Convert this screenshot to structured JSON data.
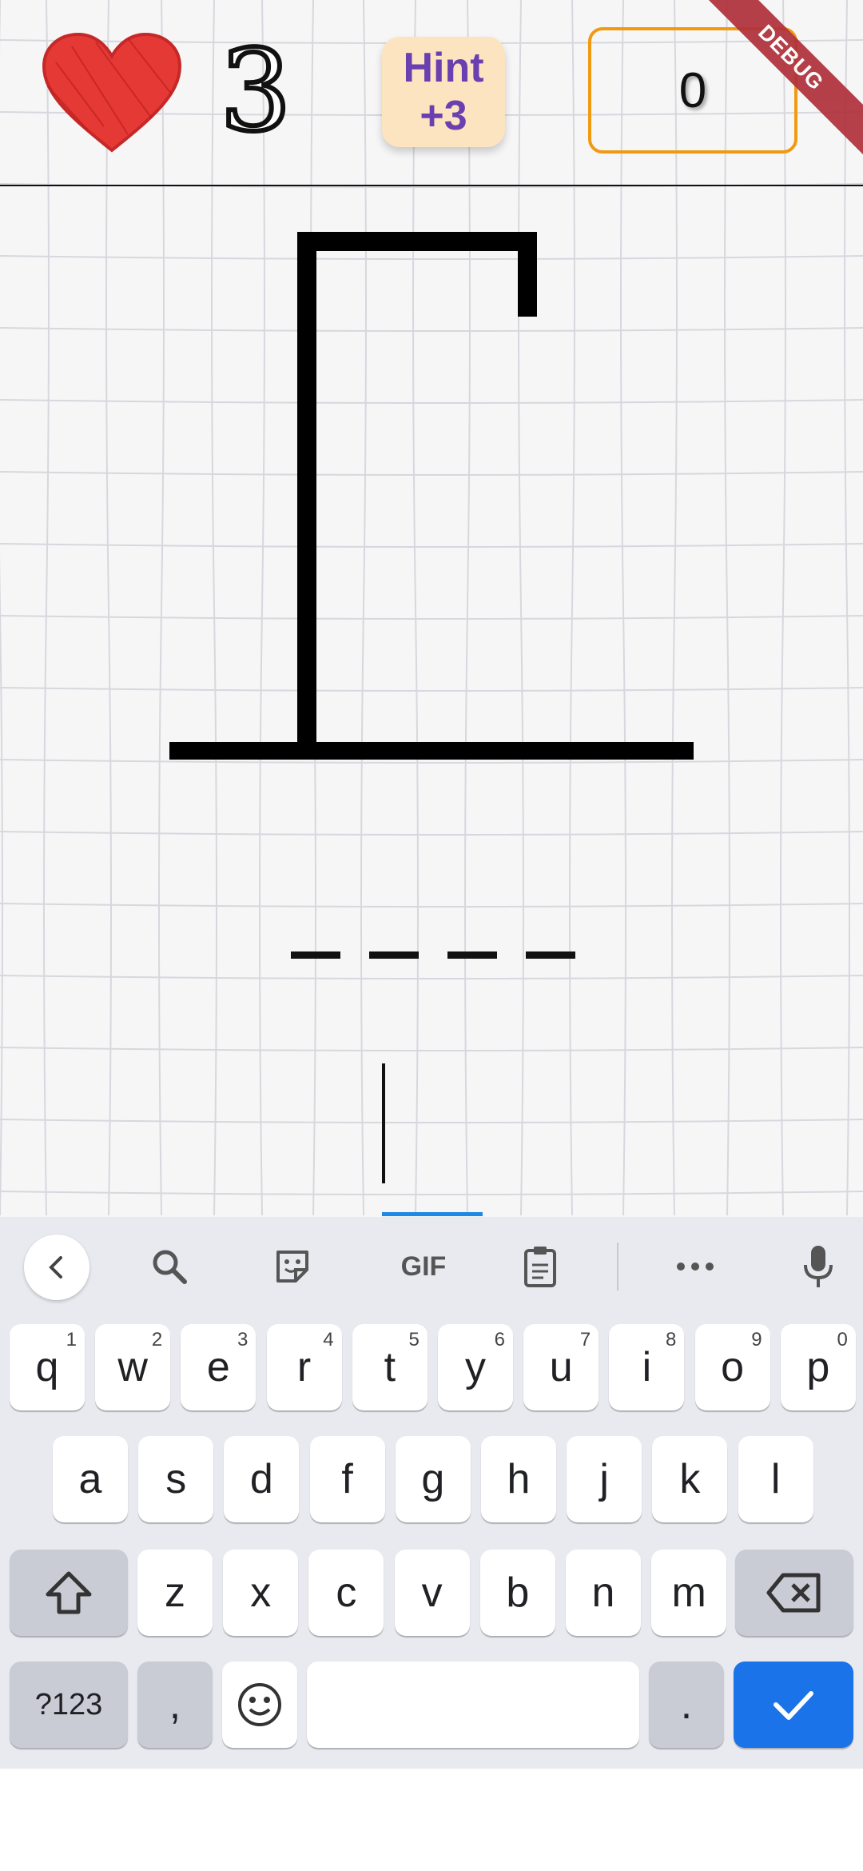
{
  "header": {
    "lives_count": "3",
    "hint_label": "Hint",
    "hint_value": "+3",
    "score": "0",
    "debug_banner": "DEBUG"
  },
  "colors": {
    "heart": "#e53935",
    "hint_bg": "#fde4c1",
    "hint_text": "#6a3fb0",
    "score_border": "#f09a12",
    "input_underline": "#1e88e5",
    "done_key": "#1a73e8"
  },
  "word": {
    "blank_count": 4
  },
  "guess_input": {
    "value": ""
  },
  "keyboard": {
    "toolbar": [
      "back-icon",
      "search-icon",
      "sticker-icon",
      "GIF",
      "clipboard-icon",
      "more-icon",
      "mic-icon"
    ],
    "row1": [
      {
        "key": "q",
        "hint": "1"
      },
      {
        "key": "w",
        "hint": "2"
      },
      {
        "key": "e",
        "hint": "3"
      },
      {
        "key": "r",
        "hint": "4"
      },
      {
        "key": "t",
        "hint": "5"
      },
      {
        "key": "y",
        "hint": "6"
      },
      {
        "key": "u",
        "hint": "7"
      },
      {
        "key": "i",
        "hint": "8"
      },
      {
        "key": "o",
        "hint": "9"
      },
      {
        "key": "p",
        "hint": "0"
      }
    ],
    "row2": [
      "a",
      "s",
      "d",
      "f",
      "g",
      "h",
      "j",
      "k",
      "l"
    ],
    "row3": [
      "z",
      "x",
      "c",
      "v",
      "b",
      "n",
      "m"
    ],
    "symbols_key": "?123",
    "comma_key": ",",
    "period_key": "."
  }
}
